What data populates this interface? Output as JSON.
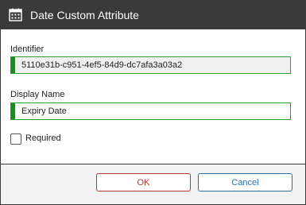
{
  "window": {
    "title": "Date Custom Attribute",
    "icon": "calendar-icon"
  },
  "form": {
    "identifier_label": "Identifier",
    "identifier_value": "5110e31b-c951-4ef5-84d9-dc7afa3a03a2",
    "display_name_label": "Display Name",
    "display_name_value": "Expiry Date",
    "required_label": "Required",
    "required_checked": false
  },
  "buttons": {
    "ok_label": "OK",
    "cancel_label": "Cancel"
  },
  "colors": {
    "titlebar": "#3a3a3a",
    "field_accent": "#1f8a1f",
    "ok_accent": "#b33a3a",
    "cancel_accent": "#2f6ea3"
  }
}
